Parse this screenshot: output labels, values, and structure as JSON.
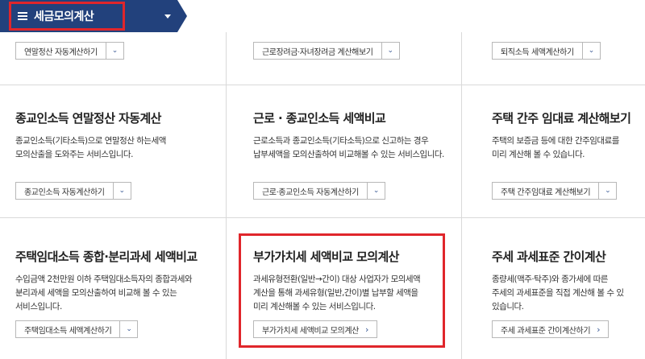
{
  "header": {
    "menu_title": "세금모의계산"
  },
  "top_row": {
    "left_select": "연말정산 자동계산하기",
    "mid_select": "근로장려금·자녀장려금 계산해보기",
    "right_select": "퇴직소득 세액계산하기"
  },
  "cards": [
    {
      "title": "종교인소득 연말정산 자동계산",
      "desc1": "종교인소득(기타소득)으로 연말정산 하는세액",
      "desc2": "모의산출을 도와주는 서비스입니다.",
      "button": "종교인소득 자동계산하기"
    },
    {
      "title": "근로 · 종교인소득 세액비교",
      "desc1": "근로소득과 종교인소득(기타소득)으로 신고하는 경우",
      "desc2": "납부세액을 모의산출하여 비교해볼 수 있는 서비스입니다.",
      "button": "근로·종교인소득 자동계산하기"
    },
    {
      "title": "주택 간주 임대료 계산해보기",
      "desc1": "주택의 보증금 등에 대한 간주임대료를",
      "desc2": "미리 계산해 볼 수 있습니다.",
      "button": "주택 간주임대료 계산해보기"
    },
    {
      "title": "주택임대소득 종합·분리과세 세액비교",
      "desc1": "수입금액 2천만원 이하 주택임대소득자의 종합과세와",
      "desc2": "분리과세 세액을 모의산출하여 비교해 볼 수 있는",
      "desc3": "서비스입니다.",
      "button": "주택임대소득 세액계산하기"
    },
    {
      "title": "부가가치세 세액비교 모의계산",
      "desc1": "과세유형전환(일반→간이) 대상 사업자가 모의세액",
      "desc2": "계산을 통해 과세유형(일반,간이)별 납부할 세액을",
      "desc3": "미리 계산해볼 수 있는 서비스입니다.",
      "button": "부가가치세 세액비교 모의계산"
    },
    {
      "title": "주세 과세표준 간이계산",
      "desc1": "종량세(맥주·탁주)와 종가세에 따른",
      "desc2": "주세의 과세표준을 직접 계산해 볼 수 있",
      "desc3": "있습니다.",
      "button": "주세 과세표준 간이계산하기"
    }
  ],
  "icons": {
    "chevron": "⌄",
    "arrow": "›"
  },
  "colors": {
    "header_blue": "#22417c",
    "highlight_red": "#e0262b"
  }
}
